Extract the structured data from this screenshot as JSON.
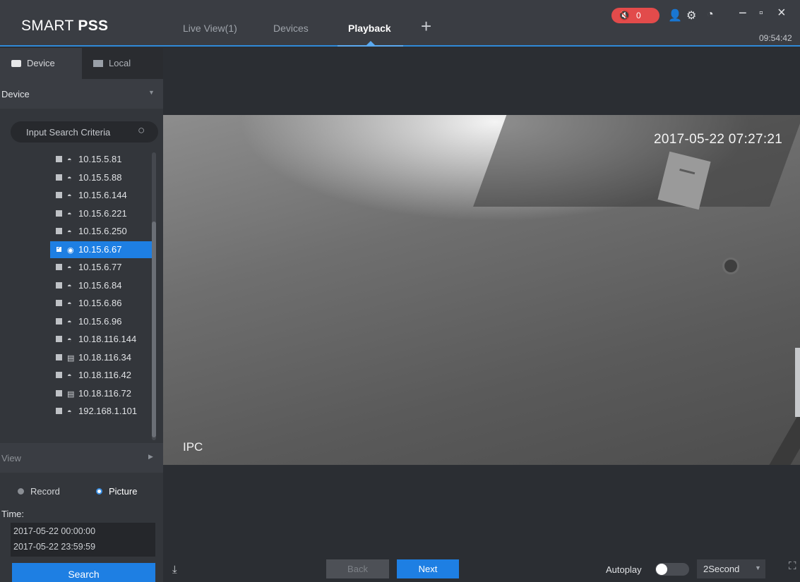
{
  "app": {
    "title_light": "SMART ",
    "title_bold": "PSS",
    "clock": "09:54:42",
    "alarm_count": "0"
  },
  "nav": {
    "tabs": [
      {
        "label": "Live View(1)",
        "active": false
      },
      {
        "label": "Devices",
        "active": false
      },
      {
        "label": "Playback",
        "active": true
      }
    ],
    "add_tab_icon": "plus-icon"
  },
  "sidebar": {
    "tabs": [
      {
        "label": "Device",
        "icon": "hdd-icon",
        "active": true
      },
      {
        "label": "Local",
        "icon": "monitor-icon",
        "active": false
      }
    ],
    "device_section": "Device",
    "search_placeholder": "Input Search Criteria",
    "devices": [
      {
        "label": "10.15.5.81",
        "icon": "camera-offline-icon",
        "checked": false
      },
      {
        "label": "10.15.5.88",
        "icon": "camera-offline-icon",
        "checked": false
      },
      {
        "label": "10.15.6.144",
        "icon": "camera-offline-icon",
        "checked": false
      },
      {
        "label": "10.15.6.221",
        "icon": "camera-offline-icon",
        "checked": false
      },
      {
        "label": "10.15.6.250",
        "icon": "camera-offline-icon",
        "checked": false
      },
      {
        "label": "10.15.6.67",
        "icon": "camera-online-icon",
        "checked": true
      },
      {
        "label": "10.15.6.77",
        "icon": "camera-offline-icon",
        "checked": false
      },
      {
        "label": "10.15.6.84",
        "icon": "camera-offline-icon",
        "checked": false
      },
      {
        "label": "10.15.6.86",
        "icon": "camera-offline-icon",
        "checked": false
      },
      {
        "label": "10.15.6.96",
        "icon": "camera-offline-icon",
        "checked": false
      },
      {
        "label": "10.18.116.144",
        "icon": "camera-offline-icon",
        "checked": false
      },
      {
        "label": "10.18.116.34",
        "icon": "nvr-icon",
        "checked": false
      },
      {
        "label": "10.18.116.42",
        "icon": "camera-offline-icon",
        "checked": false
      },
      {
        "label": "10.18.116.72",
        "icon": "nvr-icon",
        "checked": false
      },
      {
        "label": "192.168.1.101",
        "icon": "camera-offline-icon",
        "checked": false
      }
    ],
    "view_section": "View",
    "record_types": [
      {
        "label": "Record",
        "selected": false
      },
      {
        "label": "Picture",
        "selected": true
      }
    ],
    "time_label": "Time:",
    "time_start": "2017-05-22 00:00:00",
    "time_end": "2017-05-22 23:59:59",
    "search_button": "Search"
  },
  "video": {
    "timestamp": "2017-05-22 07:27:21",
    "channel": "IPC"
  },
  "toolbar": {
    "back": "Back",
    "next": "Next",
    "autoplay_label": "Autoplay",
    "autoplay_on": false,
    "interval": "2Second"
  },
  "colors": {
    "accent": "#1e7fe3",
    "alarm": "#e24b4b",
    "background": "#2b2e33"
  }
}
